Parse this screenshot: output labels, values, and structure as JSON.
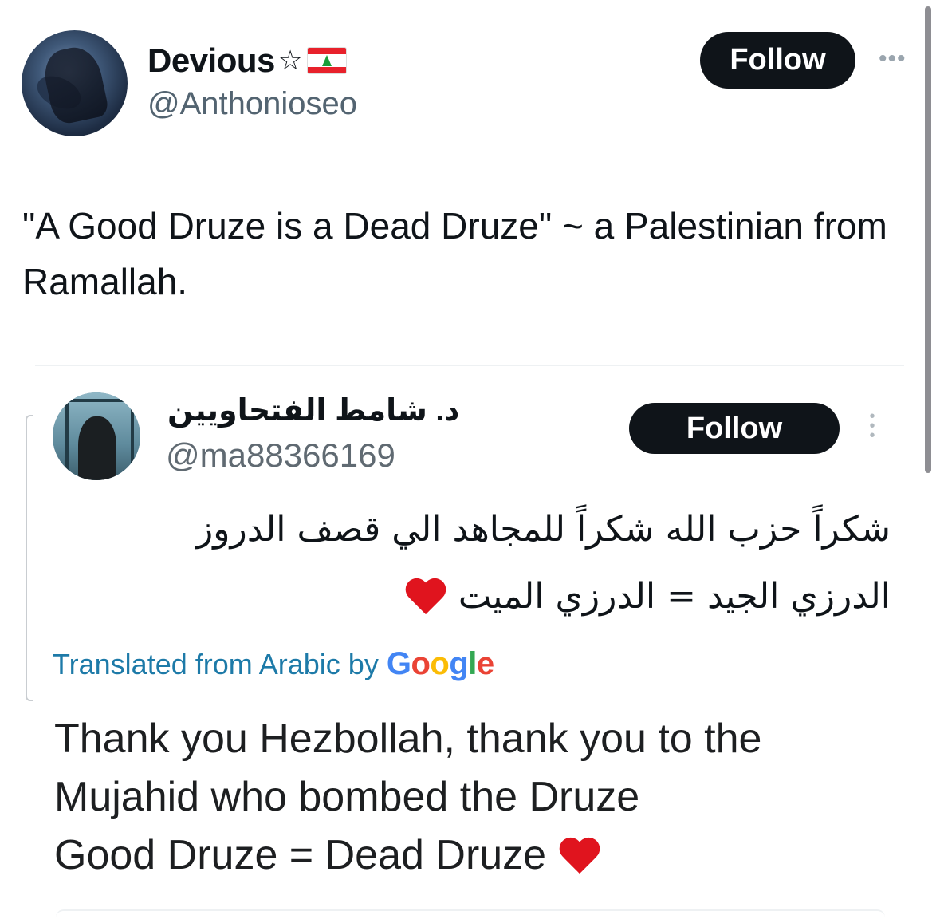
{
  "author": {
    "display_name": "Devious",
    "name_star": "☆",
    "flag": "lebanon-flag-icon",
    "handle": "@Anthonioseo",
    "follow_label": "Follow",
    "more_label": "•••"
  },
  "tweet": {
    "text": "\"A Good Druze is a Dead Druze\" ~ a Palestinian from Ramallah."
  },
  "quoted": {
    "display_name": "د. شامط الفتحاويين",
    "handle": "@ma88366169",
    "follow_label": "Follow",
    "more_label": "⋮",
    "arabic_line_1": "شكراً حزب الله شكراً للمجاهد الي قصف الدروز",
    "arabic_line_2": "الدرزي الجيد = الدرزي الميت",
    "translated_label": "Translated from Arabic by",
    "google": {
      "G": "G",
      "o1": "o",
      "o2": "o",
      "g": "g",
      "l": "l",
      "e": "e"
    },
    "translation_line_1": "Thank you Hezbollah, thank you to the",
    "translation_line_2": "Mujahid who bombed the Druze",
    "translation_line_3": "Good Druze = Dead Druze"
  },
  "colors": {
    "follow_bg": "#0f1419",
    "link_blue": "#1d7aa8",
    "heart_red": "#e0141e"
  }
}
